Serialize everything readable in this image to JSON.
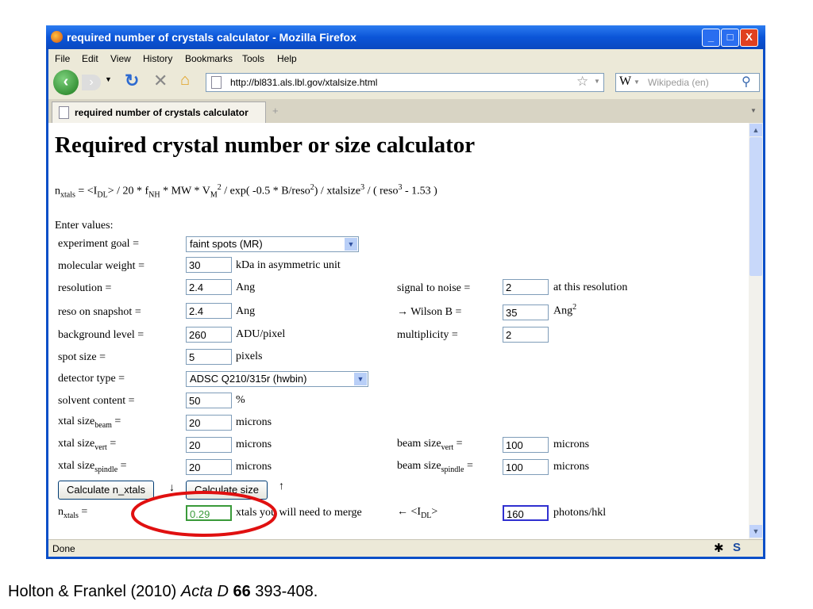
{
  "window": {
    "title": "required number of crystals calculator - Mozilla Firefox",
    "min": "_",
    "max": "□",
    "close": "X"
  },
  "menu": [
    "File",
    "Edit",
    "View",
    "History",
    "Bookmarks",
    "Tools",
    "Help"
  ],
  "nav": {
    "url": "http://bl831.als.lbl.gov/xtalsize.html",
    "search_placeholder": "Wikipedia (en)",
    "search_engine": "W"
  },
  "tab": {
    "label": "required number of crystals calculator",
    "new_tab": "+"
  },
  "page": {
    "heading": "Required crystal number or size calculator",
    "formula": {
      "n": "n",
      "n_sub": "xtals",
      "p1": " = <I",
      "p1_sub": "DL",
      "p2": "> / 20 * f",
      "p2_sub": "NH",
      "p3": " * MW * V",
      "p3_sub": "M",
      "p3_sup": "2",
      "p4": " / exp( -0.5 * B/reso",
      "p4_sup": "2",
      "p5": ") / xtalsize",
      "p5_sup": "3",
      "p6": " / ( reso",
      "p6_sup": "3",
      "p7": " - 1.53 )"
    },
    "enter_values": "Enter values:",
    "goal": {
      "label": "experiment goal =",
      "value": "faint spots (MR)"
    },
    "mw": {
      "label": "molecular weight =",
      "value": "30",
      "unit": "kDa in asymmetric unit"
    },
    "resolution": {
      "label": "resolution =",
      "value": "2.4",
      "unit": "Ang"
    },
    "snr": {
      "label": "signal to noise =",
      "value": "2",
      "unit": "at this resolution"
    },
    "reso_snap": {
      "label": "reso on snapshot =",
      "value": "2.4",
      "unit": "Ang"
    },
    "wilson": {
      "label": "→ Wilson B =",
      "value": "35",
      "unit": "Ang",
      "unit_sup": "2"
    },
    "background": {
      "label": "background level =",
      "value": "260",
      "unit": "ADU/pixel"
    },
    "multiplicity": {
      "label": "multiplicity =",
      "value": "2"
    },
    "spot": {
      "label": "spot size =",
      "value": "5",
      "unit": "pixels"
    },
    "detector": {
      "label": "detector type =",
      "value": "ADSC Q210/315r (hwbin)"
    },
    "solvent": {
      "label": "solvent content =",
      "value": "50",
      "unit": "%"
    },
    "xbeam": {
      "label": "xtal size",
      "sub": "beam",
      "eq": " =",
      "value": "20",
      "unit": "microns"
    },
    "xvert": {
      "label": "xtal size",
      "sub": "vert",
      "eq": " =",
      "value": "20",
      "unit": "microns"
    },
    "bvert": {
      "label": "beam size",
      "sub": "vert",
      "eq": " =",
      "value": "100",
      "unit": "microns"
    },
    "xspin": {
      "label": "xtal size",
      "sub": "spindle",
      "eq": " =",
      "value": "20",
      "unit": "microns"
    },
    "bspin": {
      "label": "beam size",
      "sub": "spindle",
      "eq": " =",
      "value": "100",
      "unit": "microns"
    },
    "calc_n": "Calculate n_xtals",
    "down_arrow": "↓",
    "calc_size": "Calculate size",
    "up_arrow": "↑",
    "nxtals": {
      "label": "n",
      "sub": "xtals",
      "eq": " =",
      "value": "0.29",
      "unit": "xtals you will need to merge"
    },
    "idl": {
      "label": "← <I",
      "sub": "DL",
      "end": ">",
      "value": "160",
      "unit": "photons/hkl"
    }
  },
  "status": "Done",
  "citation": {
    "authors": "Holton & Frankel (2010) ",
    "journal": "Acta D",
    "volume": "66",
    "pages": " 393-408."
  },
  "colors": {
    "titlebar": "#0b55d8",
    "highlight_circle": "#e01010",
    "result_border": "#3a9a3a",
    "focus_border": "#3030d0"
  }
}
